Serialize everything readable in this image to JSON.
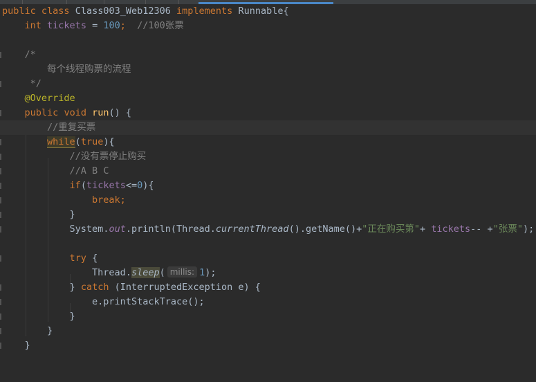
{
  "colors": {
    "background": "#2b2b2b",
    "keyword": "#cc7832",
    "number": "#6897bb",
    "comment": "#808080",
    "annotation": "#bbb529",
    "field": "#9876aa",
    "string": "#6a8759",
    "method_decl": "#ffc66d"
  },
  "code": {
    "l1": {
      "kw1": "public",
      "kw2": "class",
      "name": "Class003_Web12306",
      "kw3": "implements",
      "iface": "Runnable{"
    },
    "l2": {
      "kw": "int",
      "field": "tickets",
      "eq": " = ",
      "num": "100",
      "semi": ";",
      "comment": "//100张票"
    },
    "l4": {
      "text": "/*"
    },
    "l5": {
      "text": "每个线程购票的流程"
    },
    "l6": {
      "text": "*/"
    },
    "l7": {
      "text": "@Override"
    },
    "l8": {
      "kw1": "public",
      "kw2": "void",
      "fn": "run",
      "rest": "() {"
    },
    "l9": {
      "text": "//重复买票"
    },
    "l10": {
      "kw": "while",
      "p1": "(",
      "kw2": "true",
      "p2": "){"
    },
    "l11": {
      "text": "//没有票停止购买"
    },
    "l12": {
      "text": "//A B C"
    },
    "l13": {
      "kw": "if",
      "p1": "(",
      "field": "tickets",
      "op": "<=",
      "num": "0",
      "p2": "){"
    },
    "l14": {
      "text": "break;"
    },
    "l15": {
      "text": "}"
    },
    "l16": {
      "a": "System.",
      "out": "out",
      "b": ".println(Thread.",
      "ct": "currentThread",
      "c": "().getName()+",
      "s1": "\"正在购买第\"",
      "d": "+ ",
      "field": "tickets",
      "e": "-- +",
      "s2": "\"张票\"",
      "f": ");"
    },
    "l18": {
      "kw": "try",
      "rest": " {"
    },
    "l19": {
      "a": "Thread.",
      "sleep": "sleep",
      "p1": "(",
      "hint": "millis:",
      "num": "1",
      "p2": ");"
    },
    "l20": {
      "a": "} ",
      "kw": "catch",
      "rest": " (InterruptedException e) {"
    },
    "l21": {
      "text": "e.printStackTrace();"
    },
    "l22": {
      "text": "}"
    },
    "l23": {
      "text": "}"
    },
    "l24": {
      "text": "}"
    }
  }
}
